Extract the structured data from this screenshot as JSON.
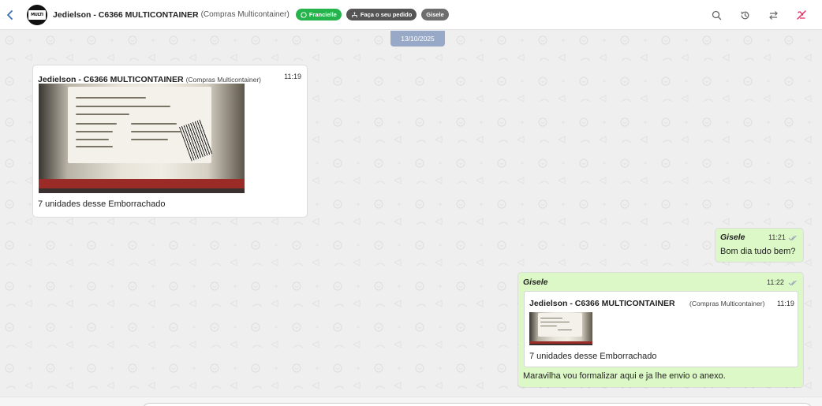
{
  "header": {
    "title": "Jedielson - C6366 MULTICONTAINER",
    "subtitle": "(Compras Multicontainer)",
    "tags": {
      "agent": "Francielle",
      "order": "Faça o seu pedido",
      "user": "Gisele"
    },
    "icons": [
      "back-icon",
      "search-icon",
      "history-icon",
      "transfer-icon",
      "close-chat-icon"
    ],
    "colors": {
      "agent_tag": "#25b34b",
      "close_icon": "#e0245e",
      "back_icon": "#3b6cb4"
    }
  },
  "chat": {
    "date_chip": "13/10/2025",
    "messages": [
      {
        "direction": "incoming",
        "sender": "Jedielson - C6366 MULTICONTAINER",
        "sender_sub": "(Compras Multicontainer)",
        "time": "11:19",
        "has_image": true,
        "text": "7 unidades desse Emborrachado"
      },
      {
        "direction": "outgoing",
        "sender": "Gisele",
        "time": "11:21",
        "text": "Bom dia tudo bem?"
      },
      {
        "direction": "outgoing",
        "sender": "Gisele",
        "time": "11:22",
        "quote": {
          "sender": "Jedielson - C6366 MULTICONTAINER",
          "sender_sub": "(Compras Multicontainer)",
          "time": "11:19",
          "has_image": true,
          "text": "7 unidades desse Emborrachado"
        },
        "text": "Maravilha vou formalizar aqui e ja lhe envio o anexo."
      }
    ],
    "colors": {
      "incoming_bubble": "#ffffff",
      "outgoing_bubble": "#dcf8c6",
      "date_chip": "#97a9c6"
    }
  }
}
